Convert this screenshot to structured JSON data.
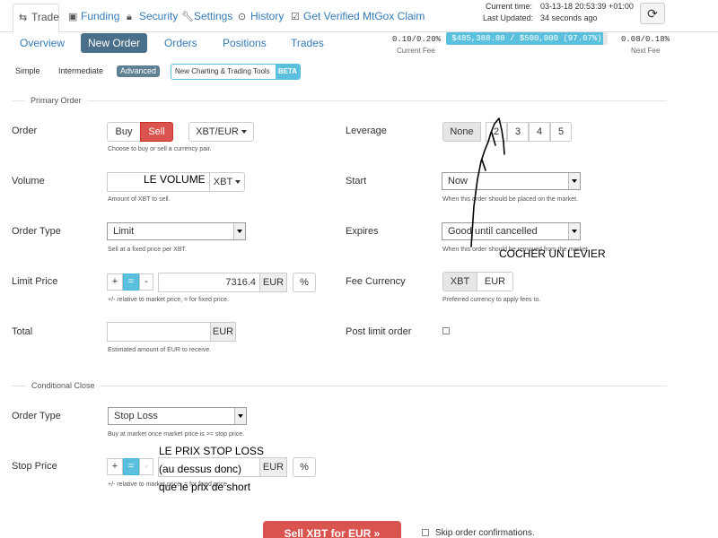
{
  "nav": {
    "tabs": [
      {
        "label": "Trade",
        "icon": "exchange-icon"
      },
      {
        "label": "Funding",
        "icon": "money-icon"
      },
      {
        "label": "Security",
        "icon": "lock-icon"
      },
      {
        "label": "Settings",
        "icon": "wrench-icon"
      },
      {
        "label": "History",
        "icon": "clock-icon"
      },
      {
        "label": "Get Verified",
        "icon": "check-icon"
      },
      {
        "label": "MtGox Claim",
        "icon": ""
      }
    ],
    "current_time_label": "Current time:",
    "current_time_value": "03-13-18 20:53:39 +01:00",
    "last_updated_label": "Last Updated:",
    "last_updated_value": "34 seconds ago",
    "refresh_icon": "refresh-icon"
  },
  "subnav": {
    "tabs": [
      "Overview",
      "New Order",
      "Orders",
      "Positions",
      "Trades"
    ],
    "current_fee": "0.10/0.20%",
    "current_fee_label": "Current Fee",
    "volume_progress": "$485,388.88 / $500,000 (97.07%)",
    "volume_progress_fraction": 0.9707,
    "next_fee": "0.08/0.18%",
    "next_fee_label": "Next Fee"
  },
  "modes": {
    "items": [
      "Simple",
      "Intermediate",
      "Advanced"
    ],
    "beta_label": "New Charting & Trading Tools",
    "beta_badge": "BETA"
  },
  "primary": {
    "title": "Primary Order",
    "order_label": "Order",
    "buy": "Buy",
    "sell": "Sell",
    "pair": "XBT/EUR",
    "order_help": "Choose to buy or sell a currency pair.",
    "volume_label": "Volume",
    "volume_currency": "XBT",
    "volume_help": "Amount of XBT to sell.",
    "order_type_label": "Order Type",
    "order_type_value": "Limit",
    "order_type_help": "Sell at a fixed price per XBT.",
    "limit_price_label": "Limit Price",
    "plus": "+",
    "equals": "=",
    "minus": "-",
    "limit_price_value": "7316.4",
    "limit_currency": "EUR",
    "percent": "%",
    "limit_help": "+/- relative to market price, = for fixed price.",
    "total_label": "Total",
    "total_currency": "EUR",
    "total_help": "Estimated amount of EUR to receive.",
    "leverage_label": "Leverage",
    "leverage_options": [
      "None",
      "2",
      "3",
      "4",
      "5"
    ],
    "start_label": "Start",
    "start_value": "Now",
    "start_help": "When this order should be placed on the market.",
    "expires_label": "Expires",
    "expires_value": "Good until cancelled",
    "expires_help": "When this order should be removed from the market.",
    "fee_currency_label": "Fee Currency",
    "fee_options": [
      "XBT",
      "EUR"
    ],
    "fee_help": "Preferred currency to apply fees to.",
    "post_limit_label": "Post limit order"
  },
  "conditional": {
    "title": "Conditional Close",
    "order_type_label": "Order Type",
    "order_type_value": "Stop Loss",
    "order_type_help": "Buy at market once market price is >= stop price.",
    "stop_price_label": "Stop Price",
    "stop_currency": "EUR",
    "stop_help": "+/- relative to market price, = for fixed price."
  },
  "footer": {
    "submit": "Sell XBT for EUR »",
    "skip_label": "Skip order confirmations."
  },
  "annotations": {
    "volume": "LE VOLUME",
    "leverage": "COCHER UN LEVIER",
    "stop_line1": "LE PRIX STOP LOSS",
    "stop_line2": "(au dessus donc)",
    "stop_line3": "que le prix de short"
  },
  "colors": {
    "accent": "#337ab7",
    "sell": "#d9534f",
    "info": "#5bc0de",
    "active_tab": "#4a6f8a"
  }
}
